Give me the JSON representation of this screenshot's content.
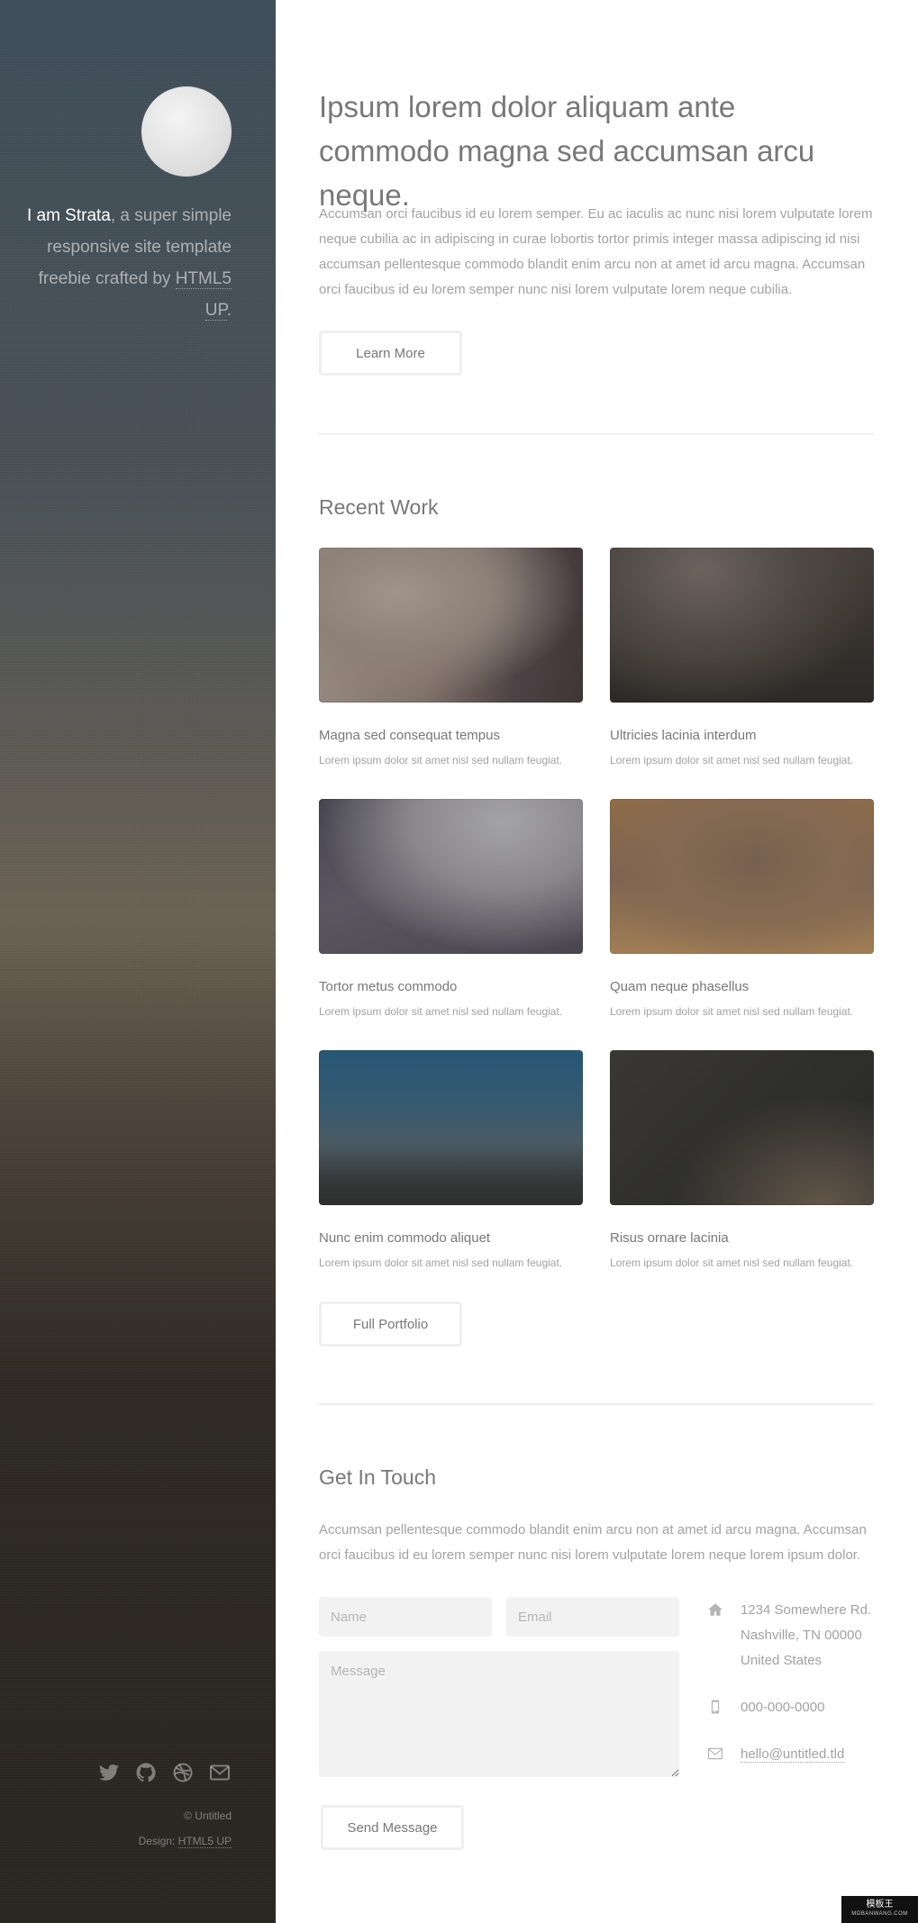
{
  "sidebar": {
    "intro_strong": "I am Strata",
    "intro_text": ", a super simple responsive site template freebie crafted by ",
    "intro_link": "HTML5 UP",
    "intro_end": ".",
    "social_icons": [
      "twitter-icon",
      "github-icon",
      "dribbble-icon",
      "envelope-icon"
    ],
    "copyright": "© Untitled",
    "design_prefix": "Design: ",
    "design_link": "HTML5 UP"
  },
  "hero": {
    "title": "Ipsum lorem dolor aliquam ante commodo magna sed accumsan arcu neque.",
    "text": "Accumsan orci faucibus id eu lorem semper. Eu ac iaculis ac nunc nisi lorem vulputate lorem neque cubilia ac in adipiscing in curae lobortis tortor primis integer massa adipiscing id nisi accumsan pellentesque commodo blandit enim arcu non at amet id arcu magna. Accumsan orci faucibus id eu lorem semper nunc nisi lorem vulputate lorem neque cubilia.",
    "button": "Learn More"
  },
  "recent_work": {
    "heading": "Recent Work",
    "items": [
      {
        "title": "Magna sed consequat tempus",
        "desc": "Lorem ipsum dolor sit amet nisl sed nullam feugiat."
      },
      {
        "title": "Ultricies lacinia interdum",
        "desc": "Lorem ipsum dolor sit amet nisl sed nullam feugiat."
      },
      {
        "title": "Tortor metus commodo",
        "desc": "Lorem ipsum dolor sit amet nisl sed nullam feugiat."
      },
      {
        "title": "Quam neque phasellus",
        "desc": "Lorem ipsum dolor sit amet nisl sed nullam feugiat."
      },
      {
        "title": "Nunc enim commodo aliquet",
        "desc": "Lorem ipsum dolor sit amet nisl sed nullam feugiat."
      },
      {
        "title": "Risus ornare lacinia",
        "desc": "Lorem ipsum dolor sit amet nisl sed nullam feugiat."
      }
    ],
    "button": "Full Portfolio"
  },
  "contact": {
    "heading": "Get In Touch",
    "text": "Accumsan pellentesque commodo blandit enim arcu non at amet id arcu magna. Accumsan orci faucibus id eu lorem semper nunc nisi lorem vulputate lorem neque lorem ipsum dolor.",
    "name_placeholder": "Name",
    "email_placeholder": "Email",
    "message_placeholder": "Message",
    "send_button": "Send Message",
    "address": "1234 Somewhere Rd.\nNashville, TN 00000\nUnited States",
    "phone": "000-000-0000",
    "email": "hello@untitled.tld"
  },
  "watermark": {
    "title": "模板王",
    "sub": "MOBANWANG.COM"
  }
}
